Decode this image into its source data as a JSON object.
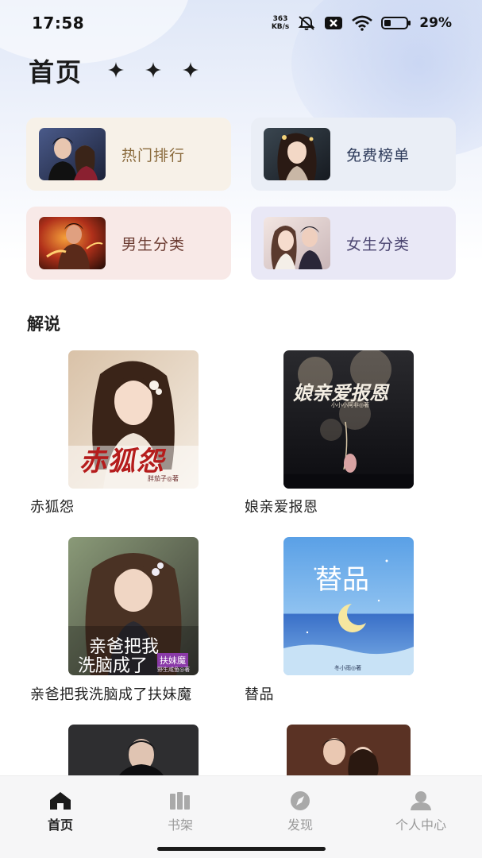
{
  "status_bar": {
    "time": "17:58",
    "net_speed_value": "363",
    "net_speed_unit": "KB/s",
    "battery_percent": "29%"
  },
  "header": {
    "title": "首页"
  },
  "categories": [
    {
      "label": "热门排行",
      "color": "#8a6a3c",
      "bg": "#f7f1e8"
    },
    {
      "label": "免费榜单",
      "color": "#2d3a5a",
      "bg": "#eaeef6"
    },
    {
      "label": "男生分类",
      "color": "#6a3a30",
      "bg": "#f8e9e7"
    },
    {
      "label": "女生分类",
      "color": "#4a4470",
      "bg": "#e9e8f6"
    }
  ],
  "section": {
    "title": "解说"
  },
  "books": [
    {
      "title": "赤狐怨",
      "cover_title": "赤狐怨",
      "cover_author": "胖茄子◎著"
    },
    {
      "title": "娘亲爱报恩",
      "cover_title": "娘亲爱报恩",
      "cover_author": "小小小阿非◎著"
    },
    {
      "title": "亲爸把我洗脑成了扶妹魔",
      "cover_title_line1": "亲爸把我",
      "cover_title_line2": "洗脑成了",
      "cover_title_tag": "扶妹魔",
      "cover_author": "野生咸鱼◎著"
    },
    {
      "title": "替品",
      "cover_title": "替品",
      "cover_author": "冬小雨◎著"
    }
  ],
  "bottom_nav": [
    {
      "label": "首页",
      "icon": "home-icon",
      "active": true
    },
    {
      "label": "书架",
      "icon": "bookshelf-icon",
      "active": false
    },
    {
      "label": "发现",
      "icon": "compass-icon",
      "active": false
    },
    {
      "label": "个人中心",
      "icon": "profile-icon",
      "active": false
    }
  ]
}
